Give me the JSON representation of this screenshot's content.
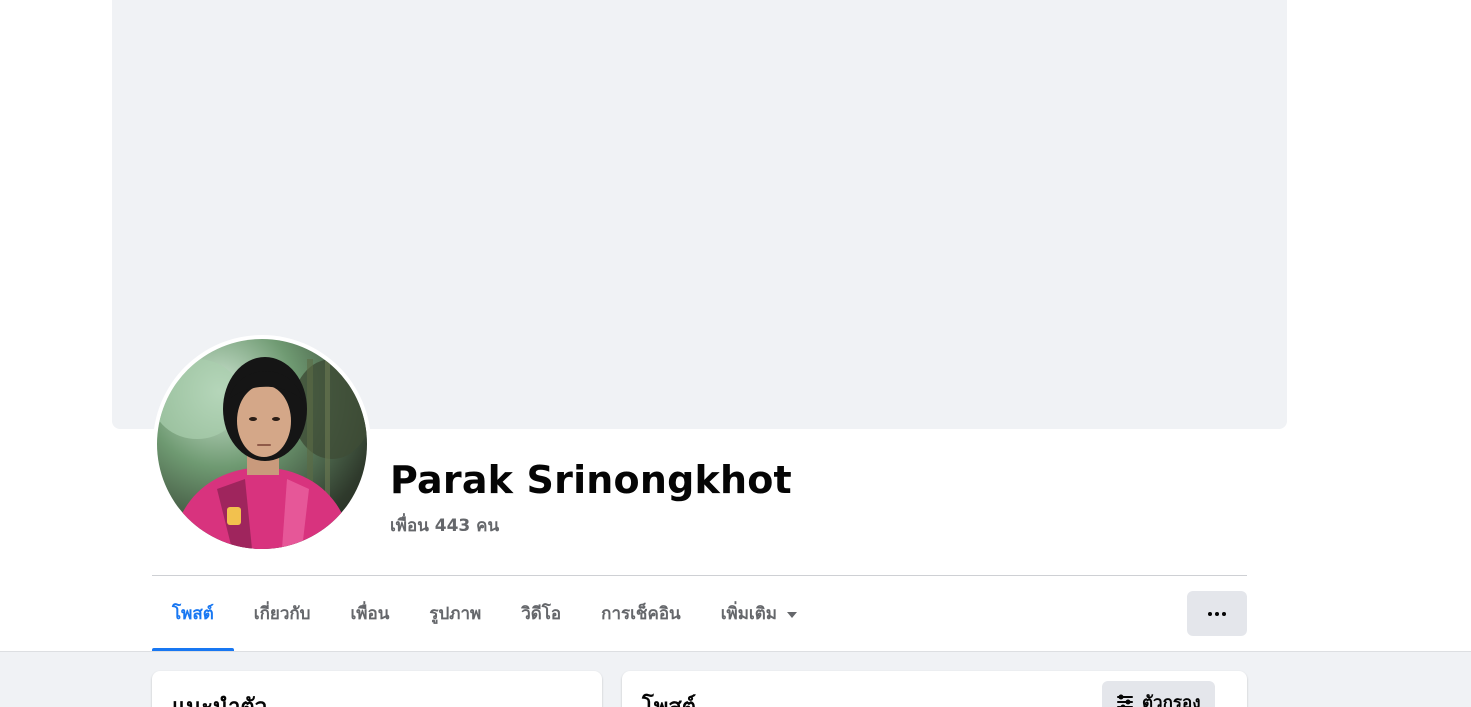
{
  "profile": {
    "name": "Parak Srinongkhot",
    "friends_text": "เพื่อน 443 คน"
  },
  "tabs": [
    {
      "label": "โพสต์",
      "active": true
    },
    {
      "label": "เกี่ยวกับ",
      "active": false
    },
    {
      "label": "เพื่อน",
      "active": false
    },
    {
      "label": "รูปภาพ",
      "active": false
    },
    {
      "label": "วิดีโอ",
      "active": false
    },
    {
      "label": "การเช็คอิน",
      "active": false
    },
    {
      "label": "เพิ่มเติม",
      "active": false
    }
  ],
  "actions": {
    "more_icon": "ellipsis-icon"
  },
  "intro_card": {
    "title": "แนะนำตัว"
  },
  "posts_card": {
    "title": "โพสต์",
    "filter_label": "ตัวกรอง",
    "filter_icon": "filter-sliders-icon"
  },
  "colors": {
    "accent": "#1877f2",
    "cover": "#f0f2f5",
    "button_bg": "#e4e6eb",
    "secondary_text": "#65676b"
  }
}
